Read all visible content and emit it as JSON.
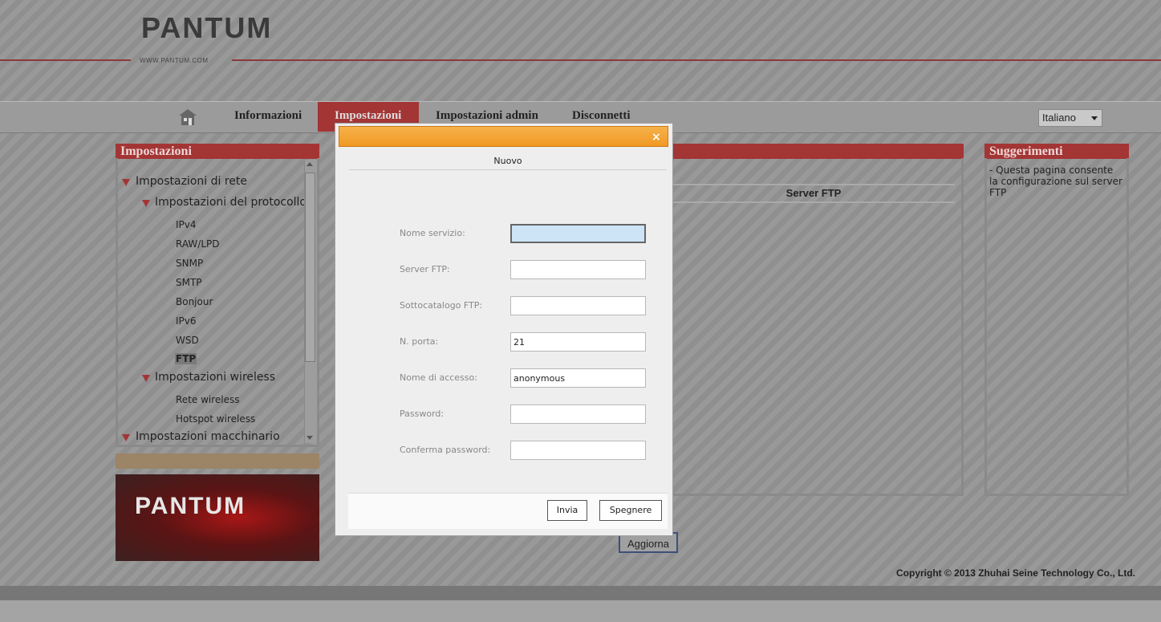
{
  "header": {
    "logo": "PANTUM",
    "url": "WWW.PANTUM.COM"
  },
  "nav": {
    "items": [
      "Informazioni",
      "Impostazioni",
      "Impostazioni admin",
      "Disconnetti"
    ],
    "active": "Impostazioni",
    "home_icon": "home-icon",
    "language": "Italiano"
  },
  "left_panel": {
    "title": "Impostazioni",
    "tree": {
      "network": "Impostazioni di rete",
      "protocol": "Impostazioni del protocollo",
      "protocol_items": [
        "IPv4",
        "RAW/LPD",
        "SNMP",
        "SMTP",
        "Bonjour",
        "IPv6",
        "WSD",
        "FTP"
      ],
      "selected": "FTP",
      "wireless": "Impostazioni wireless",
      "wireless_items": [
        "Rete wireless",
        "Hotspot wireless"
      ],
      "machine": "Impostazioni macchinario"
    },
    "banner_logo": "PANTUM"
  },
  "center_panel": {
    "column_header": "Server FTP",
    "refresh_button": "Aggiorna"
  },
  "right_panel": {
    "title": "Suggerimenti",
    "text": "- Questa pagina consente la configurazione sul server FTP"
  },
  "footer": {
    "copyright": "Copyright © 2013 Zhuhai Seine Technology Co., Ltd."
  },
  "modal": {
    "close": "×",
    "tab": "Nuovo",
    "fields": [
      {
        "label": "Nome servizio:",
        "value": ""
      },
      {
        "label": "Server FTP:",
        "value": ""
      },
      {
        "label": "Sottocatalogo FTP:",
        "value": ""
      },
      {
        "label": "N. porta:",
        "value": "21"
      },
      {
        "label": "Nome di accesso:",
        "value": "anonymous"
      },
      {
        "label": "Password:",
        "value": ""
      },
      {
        "label": "Conferma password:",
        "value": ""
      }
    ],
    "submit": "Invia",
    "cancel": "Spegnere"
  },
  "colors": {
    "accent_red": "#a33535",
    "modal_orange": "#f09a24",
    "focus_blue": "#cde4f7"
  }
}
